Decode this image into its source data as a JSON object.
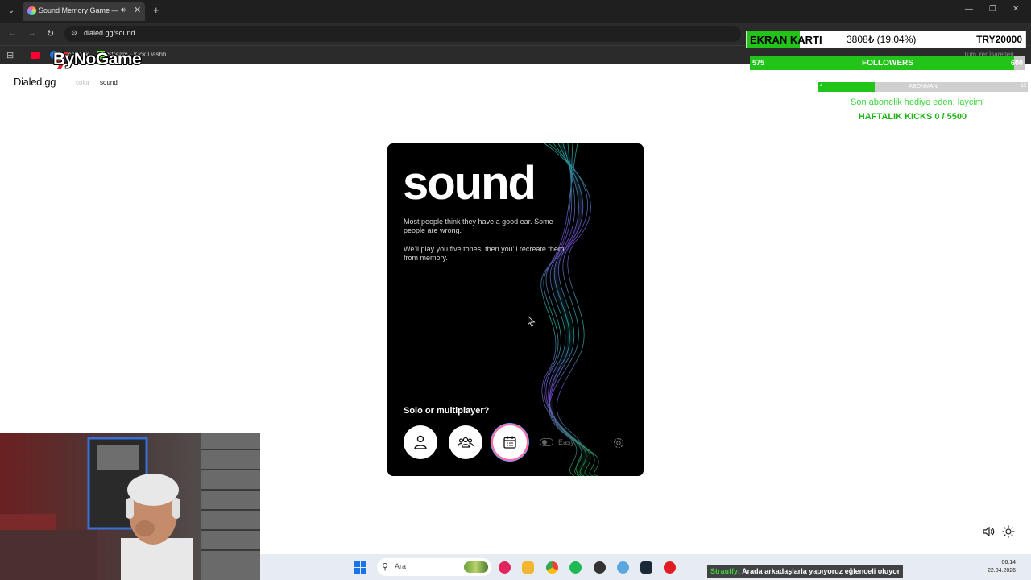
{
  "browser": {
    "tab_title": "Sound Memory Game — H",
    "url": "dialed.gg/sound",
    "bookmarks": [
      "Facebook",
      "Stream - Kick Dashb..."
    ],
    "bookmarks_right": "Tüm Yer İşaretleri"
  },
  "overlay": {
    "logo_text": "ByNoGame",
    "ekran": {
      "label": "EKRAN KARTI",
      "value": "3808₺ (19.04%)",
      "goal": "TRY20000",
      "progress": 0.1904
    },
    "followers": {
      "current": "575",
      "label": "FOLLOWERS",
      "goal": "600",
      "progress": 0.958
    },
    "abone": {
      "current": "4",
      "label": "ABONMAN",
      "goal": "15",
      "progress": 0.27
    },
    "gift_text": "Son abonelik hediye eden: laycim",
    "kicks_text": "HAFTALIK KICKS 0 / 5500",
    "chat_user": "Strauffy",
    "chat_message": ": Arada arkadaşlarla yapıyoruz eğlenceli oluyor"
  },
  "site": {
    "logo": "Dialed.gg",
    "nav": {
      "color": "color",
      "sound": "sound"
    }
  },
  "card": {
    "title": "sound",
    "para1": "Most people think they have a good ear. Some people are wrong.",
    "para2": "We'll play you five tones, then you'll recreate them from memory.",
    "question": "Solo or multiplayer?",
    "easy_label": "Easy",
    "icons": [
      "person-icon",
      "group-icon",
      "calendar-icon",
      "settings-icon"
    ]
  },
  "taskbar": {
    "search_placeholder": "Ara",
    "time": "06:14",
    "date": "22.04.2026"
  },
  "colors": {
    "accent_green": "#22c41a",
    "card_bg": "#000000",
    "wave_teal": "#2dd4bf",
    "wave_purple": "#8b5cf6"
  }
}
